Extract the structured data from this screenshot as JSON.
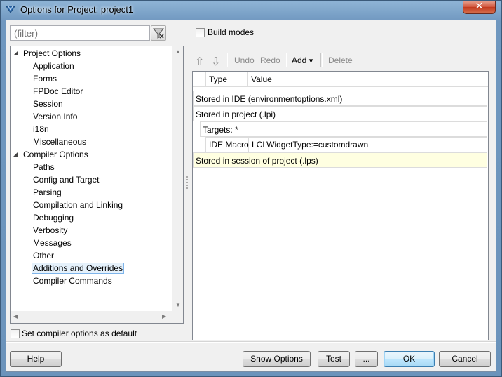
{
  "window": {
    "title": "Options for Project: project1",
    "close_glyph": "✕"
  },
  "filter": {
    "placeholder": "(filter)"
  },
  "build_modes": {
    "label": "Build modes",
    "checked": false
  },
  "tree": {
    "items": [
      {
        "label": "Project Options",
        "level": 0,
        "expanded": true
      },
      {
        "label": "Application",
        "level": 1
      },
      {
        "label": "Forms",
        "level": 1
      },
      {
        "label": "FPDoc Editor",
        "level": 1
      },
      {
        "label": "Session",
        "level": 1
      },
      {
        "label": "Version Info",
        "level": 1
      },
      {
        "label": "i18n",
        "level": 1
      },
      {
        "label": "Miscellaneous",
        "level": 1
      },
      {
        "label": "Compiler Options",
        "level": 0,
        "expanded": true
      },
      {
        "label": "Paths",
        "level": 1
      },
      {
        "label": "Config and Target",
        "level": 1
      },
      {
        "label": "Parsing",
        "level": 1
      },
      {
        "label": "Compilation and Linking",
        "level": 1
      },
      {
        "label": "Debugging",
        "level": 1
      },
      {
        "label": "Verbosity",
        "level": 1
      },
      {
        "label": "Messages",
        "level": 1
      },
      {
        "label": "Other",
        "level": 1
      },
      {
        "label": "Additions and Overrides",
        "level": 1,
        "selected": true
      },
      {
        "label": "Compiler Commands",
        "level": 1
      }
    ]
  },
  "toolbar": {
    "move_up": "⇧",
    "move_down": "⇩",
    "undo": "Undo",
    "redo": "Redo",
    "add": "Add",
    "add_arrow": "▾",
    "delete": "Delete"
  },
  "grid": {
    "columns": [
      "Type",
      "Value"
    ],
    "rows": [
      {
        "text": "Stored in IDE (environmentoptions.xml)"
      },
      {
        "text": "Stored in project (.lpi)"
      },
      {
        "text": "Targets: *"
      },
      {
        "type": "IDE Macro",
        "value": "LCLWidgetType:=customdrawn"
      },
      {
        "text": "Stored in session of project (.lps)"
      }
    ]
  },
  "set_default": {
    "label": "Set compiler options as default",
    "checked": false
  },
  "buttons": {
    "help": "Help",
    "show_options": "Show Options",
    "test": "Test",
    "more": "...",
    "ok": "OK",
    "cancel": "Cancel"
  },
  "colors": {
    "title_bar": "#6f97bf",
    "close_button": "#c94a2c",
    "selection_border": "#7eb4ea",
    "tooltip_row": "#ffffe1"
  }
}
